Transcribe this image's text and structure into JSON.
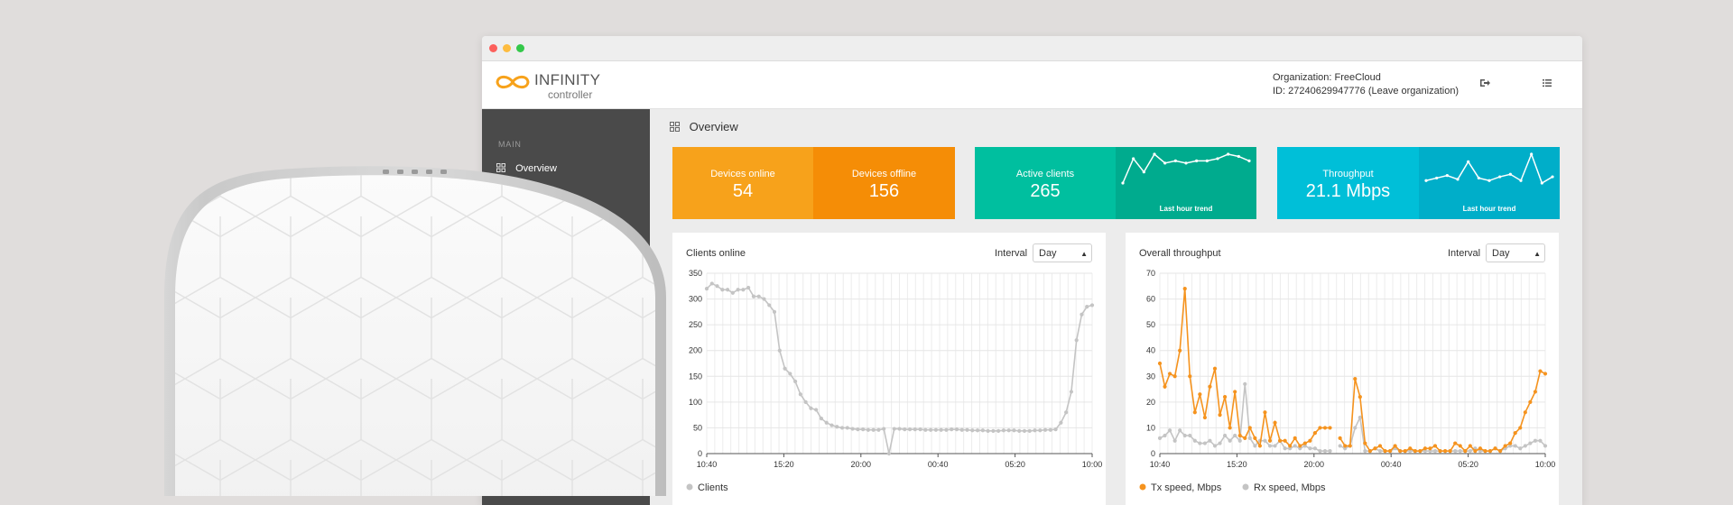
{
  "app": {
    "brand": "INFINITY",
    "brand_sub": "controller",
    "org_line": "Organization: FreeCloud",
    "id_line": "ID: 27240629947776 (Leave organization)",
    "accent_color": "#f7a21b"
  },
  "header_icons": [
    "logout-icon",
    "list-icon"
  ],
  "sidebar": {
    "section": "MAIN",
    "items": [
      {
        "label": "Overview",
        "icon": "grid-icon"
      }
    ]
  },
  "page": {
    "title": "Overview"
  },
  "cards": {
    "devices_online": {
      "label": "Devices online",
      "value": "54",
      "color": "#f7a21b"
    },
    "devices_offline": {
      "label": "Devices offline",
      "value": "156",
      "color": "#f58d06"
    },
    "active_clients": {
      "label": "Active clients",
      "value": "265",
      "trend": "Last hour trend",
      "color": "#00bf9f",
      "trend_color": "#00ab8e",
      "trend_values": [
        3,
        14,
        8,
        16,
        12,
        13,
        12,
        13,
        13,
        14,
        16,
        15,
        13
      ]
    },
    "throughput": {
      "label": "Throughput",
      "value": "21.1 Mbps",
      "trend": "Last hour trend",
      "color": "#00bfd8",
      "trend_color": "#00aec9",
      "trend_values": [
        6,
        8,
        10,
        7,
        21,
        8,
        6,
        9,
        11,
        6,
        27,
        4,
        9
      ]
    }
  },
  "clients_chart": {
    "title": "Clients online",
    "interval_label": "Interval",
    "interval_value": "Day",
    "legend": "Clients"
  },
  "throughput_chart": {
    "title": "Overall throughput",
    "interval_label": "Interval",
    "interval_value": "Day",
    "legend_tx": "Tx speed, Mbps",
    "legend_rx": "Rx speed, Mbps"
  },
  "chart_data": [
    {
      "type": "line",
      "title": "Clients online",
      "x_tick_labels": [
        "10:40",
        "15:20",
        "20:00",
        "00:40",
        "05:20",
        "10:00"
      ],
      "ylim": [
        0,
        350
      ],
      "y_ticks": [
        0,
        50,
        100,
        150,
        200,
        250,
        300,
        350
      ],
      "grid": true,
      "legend_position": "bottom-left",
      "series": [
        {
          "name": "Clients",
          "color": "#c4c4c4",
          "values": [
            320,
            330,
            325,
            318,
            318,
            312,
            318,
            318,
            322,
            305,
            305,
            300,
            288,
            275,
            200,
            165,
            155,
            140,
            115,
            100,
            88,
            85,
            68,
            60,
            55,
            52,
            50,
            50,
            48,
            47,
            47,
            46,
            46,
            46,
            48,
            0,
            48,
            48,
            47,
            47,
            47,
            47,
            46,
            46,
            46,
            46,
            46,
            47,
            47,
            46,
            46,
            45,
            45,
            45,
            44,
            44,
            44,
            45,
            45,
            45,
            44,
            44,
            44,
            45,
            45,
            46,
            46,
            47,
            60,
            80,
            120,
            220,
            270,
            285,
            288
          ]
        }
      ]
    },
    {
      "type": "line",
      "title": "Overall throughput",
      "x_tick_labels": [
        "10:40",
        "15:20",
        "20:00",
        "00:40",
        "05:20",
        "10:00"
      ],
      "ylim": [
        0,
        70
      ],
      "y_ticks": [
        0,
        10,
        20,
        30,
        40,
        50,
        60,
        70
      ],
      "grid": true,
      "legend_position": "bottom-left",
      "series": [
        {
          "name": "Tx speed, Mbps",
          "color": "#f5931e",
          "values": [
            35,
            26,
            31,
            30,
            40,
            64,
            30,
            16,
            23,
            14,
            26,
            33,
            15,
            22,
            10,
            24,
            7,
            6,
            10,
            6,
            3,
            16,
            5,
            12,
            5,
            5,
            3,
            6,
            3,
            4,
            5,
            8,
            10,
            10,
            10,
            null,
            6,
            3,
            3,
            29,
            22,
            4,
            1,
            2,
            3,
            1,
            1,
            3,
            1,
            1,
            2,
            1,
            1,
            2,
            2,
            3,
            1,
            1,
            1,
            4,
            3,
            1,
            3,
            1,
            2,
            1,
            1,
            2,
            1,
            3,
            4,
            8,
            10,
            16,
            20,
            24,
            32,
            31
          ]
        },
        {
          "name": "Rx speed, Mbps",
          "color": "#c4c4c4",
          "values": [
            6,
            7,
            9,
            5,
            9,
            7,
            7,
            5,
            4,
            4,
            5,
            3,
            4,
            7,
            5,
            7,
            5,
            27,
            6,
            3,
            5,
            5,
            3,
            3,
            5,
            2,
            2,
            3,
            2,
            3,
            2,
            2,
            1,
            1,
            1,
            null,
            3,
            2,
            3,
            10,
            14,
            1,
            1,
            2,
            1,
            1,
            1,
            2,
            1,
            1,
            1,
            1,
            1,
            1,
            1,
            1,
            1,
            1,
            1,
            1,
            1,
            1,
            1,
            2,
            1,
            1,
            1,
            2,
            1,
            2,
            3,
            3,
            2,
            3,
            4,
            5,
            5,
            3
          ]
        }
      ]
    }
  ]
}
